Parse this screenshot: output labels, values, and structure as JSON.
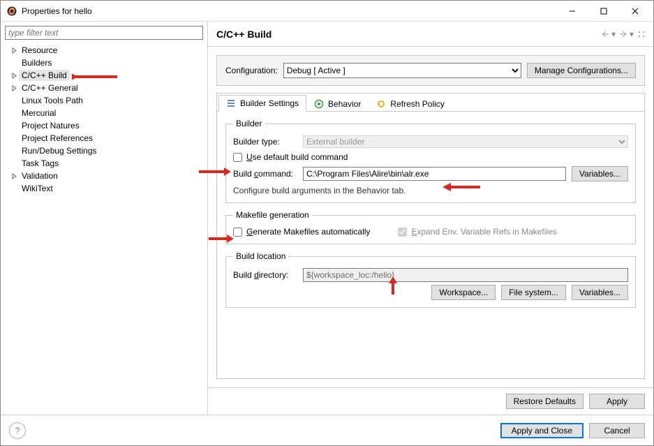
{
  "window": {
    "title": "Properties for hello"
  },
  "filter_placeholder": "type filter text",
  "tree": {
    "items": [
      {
        "label": "Resource",
        "expandable": true
      },
      {
        "label": "Builders",
        "expandable": false
      },
      {
        "label": "C/C++ Build",
        "expandable": true,
        "selected": true
      },
      {
        "label": "C/C++ General",
        "expandable": true
      },
      {
        "label": "Linux Tools Path",
        "expandable": false
      },
      {
        "label": "Mercurial",
        "expandable": false
      },
      {
        "label": "Project Natures",
        "expandable": false
      },
      {
        "label": "Project References",
        "expandable": false
      },
      {
        "label": "Run/Debug Settings",
        "expandable": false
      },
      {
        "label": "Task Tags",
        "expandable": false
      },
      {
        "label": "Validation",
        "expandable": true
      },
      {
        "label": "WikiText",
        "expandable": false
      }
    ]
  },
  "page_title": "C/C++ Build",
  "config": {
    "label": "Configuration:",
    "selected": "Debug  [ Active ]",
    "manage_btn": "Manage Configurations..."
  },
  "tabs": {
    "builder_settings": "Builder Settings",
    "behavior": "Behavior",
    "refresh_policy": "Refresh Policy"
  },
  "builder": {
    "legend": "Builder",
    "type_label": "Builder type:",
    "type_value": "External builder",
    "use_default": {
      "pre": "",
      "u": "U",
      "post": "se default build command"
    },
    "build_cmd_label": {
      "pre": "Build ",
      "u": "c",
      "post": "ommand:"
    },
    "build_cmd_value": "C:\\Program Files\\Alire\\bin\\alr.exe",
    "variables_btn": "Variables...",
    "note": "Configure build arguments in the Behavior tab."
  },
  "makefile": {
    "legend": "Makefile generation",
    "generate": {
      "pre": "",
      "u": "G",
      "post": "enerate Makefiles automatically"
    },
    "expand": {
      "pre": "",
      "u": "E",
      "post": "xpand Env. Variable Refs in Makefiles"
    }
  },
  "buildloc": {
    "legend": "Build location",
    "dir_label": {
      "pre": "Build ",
      "u": "d",
      "post": "irectory:"
    },
    "dir_value": "${workspace_loc:/hello}",
    "workspace_btn": "Workspace...",
    "filesystem_btn": "File system...",
    "variables_btn": "Variables..."
  },
  "buttons": {
    "restore_defaults": "Restore Defaults",
    "apply": "Apply",
    "apply_close": "Apply and Close",
    "cancel": "Cancel"
  }
}
